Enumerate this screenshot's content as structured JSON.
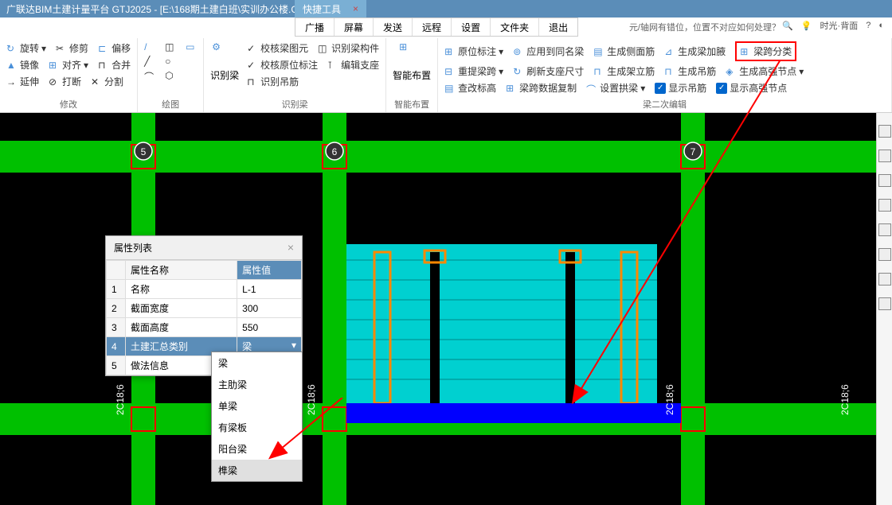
{
  "titlebar": {
    "text": "广联达BIM土建计量平台 GTJ2025 - [E:\\168期土建白班\\实训办公楼.G",
    "tab_title": "快捷工具"
  },
  "top_menu": {
    "items": [
      "广播",
      "屏幕",
      "发送",
      "远程",
      "设置",
      "文件夹",
      "退出"
    ]
  },
  "help_text": "元/轴网有错位，位置不对应如何处理？",
  "top_right": {
    "items": [
      "时光·背面"
    ]
  },
  "ribbon": {
    "groups": [
      {
        "label": "修改",
        "items_row1": [
          {
            "label": "旋转"
          },
          {
            "label": "修剪"
          },
          {
            "label": "偏移"
          }
        ],
        "items_row2": [
          {
            "label": "镜像"
          },
          {
            "label": "对齐"
          },
          {
            "label": "合并"
          }
        ],
        "items_row3": [
          {
            "label": "延伸"
          },
          {
            "label": "打断"
          },
          {
            "label": "分割"
          }
        ]
      },
      {
        "label": "绘图",
        "items": []
      },
      {
        "label": "识别梁",
        "large_label": "识别梁",
        "items_row1": [
          {
            "label": "校核梁图元"
          },
          {
            "label": "识别梁构件"
          }
        ],
        "items_row2": [
          {
            "label": "校核原位标注"
          },
          {
            "label": "编辑支座"
          }
        ],
        "items_row3": [
          {
            "label": "识别吊筋"
          }
        ]
      },
      {
        "label": "智能布置",
        "large_label": "智能布置"
      },
      {
        "label": "梁二次编辑",
        "items_row1": [
          {
            "label": "原位标注"
          },
          {
            "label": "应用到同名梁"
          },
          {
            "label": "生成侧面筋"
          },
          {
            "label": "生成梁加腋"
          },
          {
            "label": "梁跨分类",
            "highlighted": true
          }
        ],
        "items_row2": [
          {
            "label": "重提梁跨"
          },
          {
            "label": "刷新支座尺寸"
          },
          {
            "label": "生成架立筋"
          },
          {
            "label": "生成吊筋"
          },
          {
            "label": "生成高强节点"
          }
        ],
        "items_row3": [
          {
            "label": "查改标高"
          },
          {
            "label": "梁跨数据复制"
          },
          {
            "label": "设置拱梁"
          },
          {
            "label": "显示吊筋",
            "checkbox": true
          },
          {
            "label": "显示高强节点",
            "checkbox": true
          }
        ]
      }
    ]
  },
  "properties_panel": {
    "title": "属性列表",
    "headers": {
      "name": "属性名称",
      "value": "属性值"
    },
    "rows": [
      {
        "num": "1",
        "name": "名称",
        "value": "L-1"
      },
      {
        "num": "2",
        "name": "截面宽度",
        "value": "300"
      },
      {
        "num": "3",
        "name": "截面高度",
        "value": "550"
      },
      {
        "num": "4",
        "name": "土建汇总类别",
        "value": "梁",
        "selected": true
      },
      {
        "num": "5",
        "name": "做法信息",
        "value": ""
      }
    ]
  },
  "dropdown": {
    "items": [
      "梁",
      "主肋梁",
      "单梁",
      "有梁板",
      "阳台梁",
      "榫梁"
    ]
  },
  "drawing_labels": {
    "grid5": "5",
    "grid6": "6",
    "grid7": "7",
    "annotation1": "2C18;6",
    "annotation2": "2C18;6",
    "annotation3": "2C18;6"
  }
}
